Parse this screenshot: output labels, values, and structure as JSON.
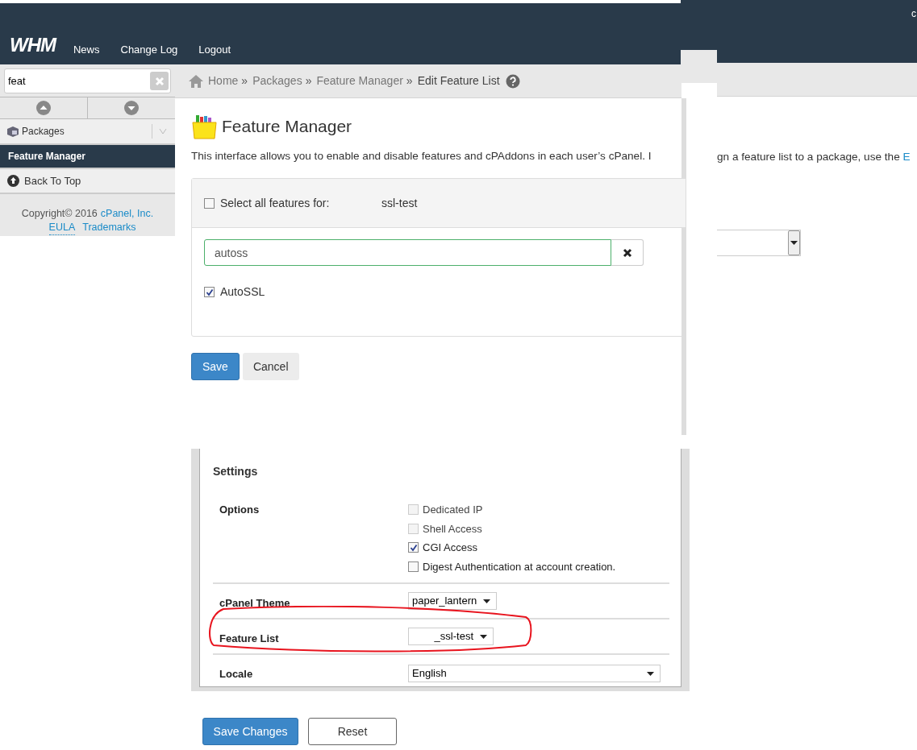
{
  "header": {
    "logo": "WHM",
    "nav": [
      "News",
      "Change Log",
      "Logout"
    ],
    "corner_text": "c"
  },
  "sidebar": {
    "search": {
      "value": "feat"
    },
    "group": {
      "label": "Packages"
    },
    "items": [
      {
        "label": "Feature Manager",
        "selected": true
      }
    ],
    "back_to_top": "Back To Top",
    "copyright": "Copyright© 2016",
    "company_link": "cPanel, Inc.",
    "links": [
      "EULA",
      "Trademarks"
    ]
  },
  "breadcrumb": {
    "items": [
      "Home",
      "Packages",
      "Feature Manager"
    ],
    "separator": "»",
    "current": "Edit Feature List"
  },
  "feature_manager": {
    "title": "Feature Manager",
    "intro_left": "This interface allows you to enable and disable features and cPAddons in each user’s cPanel. I",
    "intro_right": "gn a feature list to a package, use the",
    "intro_link": "E",
    "select_all": {
      "label": "Select all features for:",
      "account": "ssl-test",
      "checked": false
    },
    "filter": {
      "value": "autoss"
    },
    "features": [
      {
        "label": "AutoSSL",
        "checked": true
      }
    ],
    "buttons": [
      {
        "label": "Save",
        "kind": "primary"
      },
      {
        "label": "Cancel",
        "kind": "default"
      }
    ]
  },
  "settings": {
    "title": "Settings",
    "rows": [
      {
        "label": "Options",
        "kind": "checkboxes",
        "options": [
          {
            "label": "Dedicated IP",
            "checked": false,
            "disabled": true
          },
          {
            "label": "Shell Access",
            "checked": false,
            "disabled": true
          },
          {
            "label": "CGI Access",
            "checked": true,
            "disabled": false
          },
          {
            "label": "Digest Authentication at account creation.",
            "checked": false,
            "disabled": false
          }
        ]
      },
      {
        "label": "cPanel Theme",
        "kind": "select",
        "value": "paper_lantern",
        "highlighted": false
      },
      {
        "label": "Feature List",
        "kind": "select",
        "value": "_ssl-test",
        "highlighted": true
      },
      {
        "label": "Locale",
        "kind": "wide-select",
        "value": "English",
        "highlighted": false
      }
    ]
  },
  "form_buttons": [
    {
      "label": "Save Changes",
      "kind": "primary"
    },
    {
      "label": "Reset",
      "kind": "outline"
    }
  ]
}
